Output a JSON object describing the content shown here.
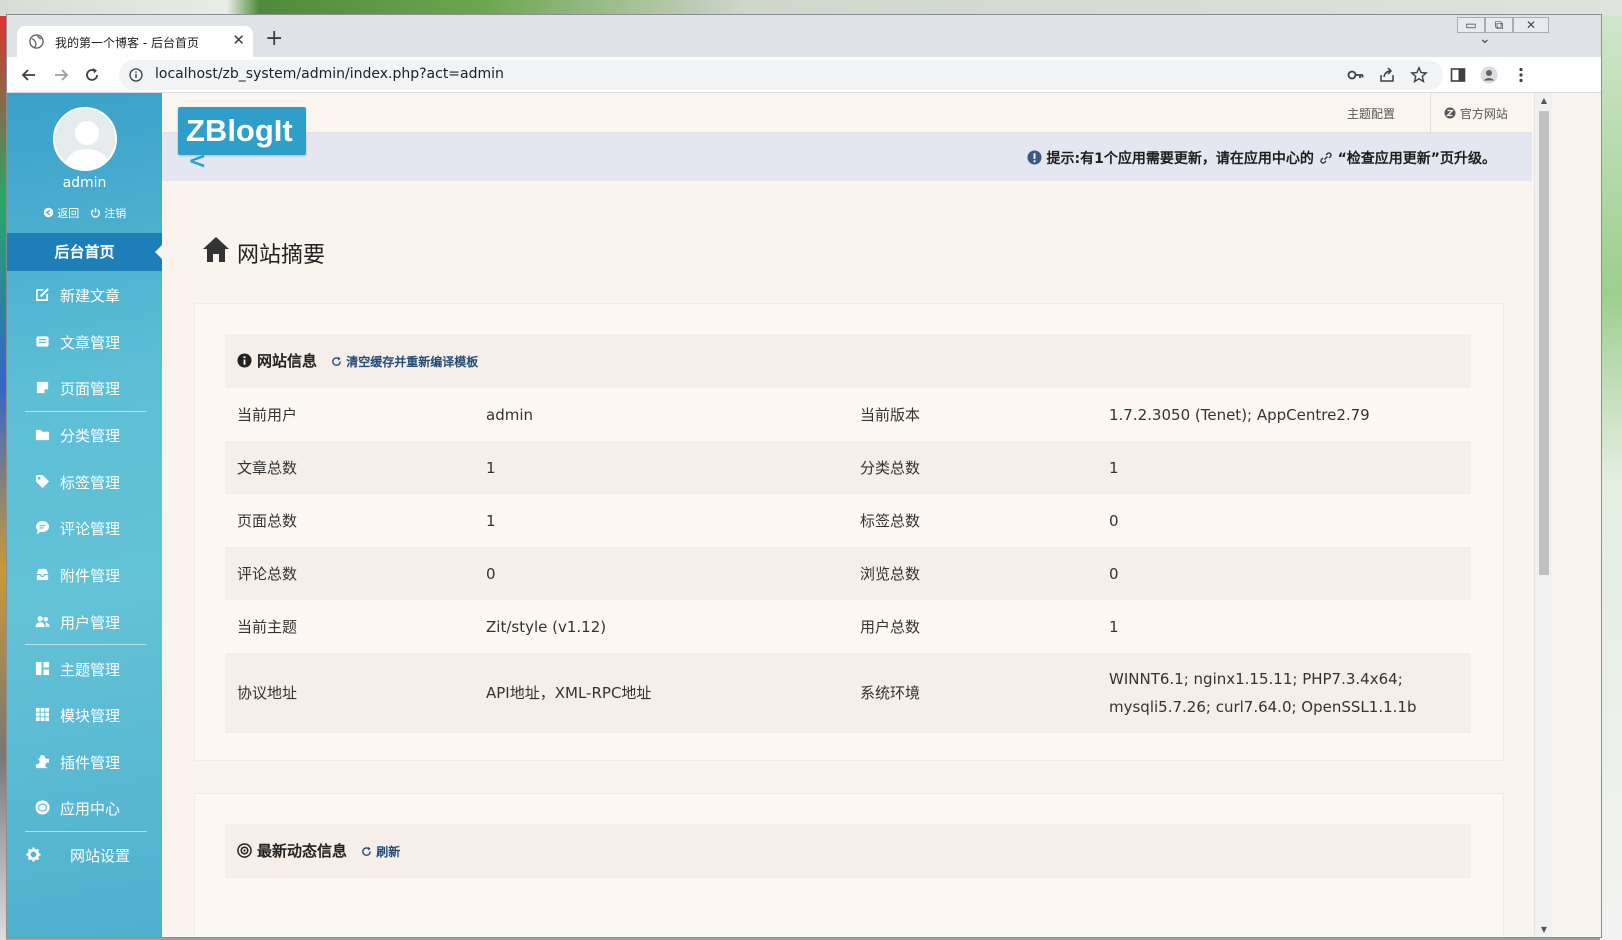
{
  "browser": {
    "tab_title": "我的第一个博客 - 后台首页",
    "tab_close": "✕",
    "new_tab": "+",
    "tab_list": "⌄",
    "url": "localhost/zb_system/admin/index.php?act=admin",
    "window_controls": [
      "▭",
      "⧉",
      "✕"
    ]
  },
  "sidebar": {
    "user": "admin",
    "return_label": "返回",
    "logout_label": "注销",
    "home_label": "后台首页",
    "items": [
      {
        "label": "新建文章",
        "icon": "edit-icon"
      },
      {
        "label": "文章管理",
        "icon": "article-icon"
      },
      {
        "label": "页面管理",
        "icon": "page-icon"
      },
      {
        "label": "分类管理",
        "icon": "folder-icon"
      },
      {
        "label": "标签管理",
        "icon": "tag-icon"
      },
      {
        "label": "评论管理",
        "icon": "comment-icon"
      },
      {
        "label": "附件管理",
        "icon": "attachment-icon"
      },
      {
        "label": "用户管理",
        "icon": "users-icon"
      },
      {
        "label": "主题管理",
        "icon": "theme-icon"
      },
      {
        "label": "模块管理",
        "icon": "module-icon"
      },
      {
        "label": "插件管理",
        "icon": "plugin-icon"
      },
      {
        "label": "应用中心",
        "icon": "app-center-icon"
      },
      {
        "label": "网站设置",
        "icon": "gear-icon"
      }
    ]
  },
  "header": {
    "logo": "ZBlogIt",
    "logo_arrow": "<",
    "theme_config": "主题配置",
    "official_site": "官方网站",
    "notice_prefix": "提示:有1个应用需要更新，请在应用中心的",
    "notice_link": "“检查应用更新”",
    "notice_suffix": "页升级。"
  },
  "main": {
    "page_title": "网站摘要",
    "site_info": {
      "title": "网站信息",
      "action": "清空缓存并重新编译模板",
      "rows": [
        {
          "k1": "当前用户",
          "v1": "admin",
          "k2": "当前版本",
          "v2": "1.7.2.3050 (Tenet); AppCentre2.79"
        },
        {
          "k1": "文章总数",
          "v1": "1",
          "k2": "分类总数",
          "v2": "1"
        },
        {
          "k1": "页面总数",
          "v1": "1",
          "k2": "标签总数",
          "v2": "0"
        },
        {
          "k1": "评论总数",
          "v1": "0",
          "k2": "浏览总数",
          "v2": "0"
        },
        {
          "k1": "当前主题",
          "v1": "Zit/style (v1.12)",
          "k2": "用户总数",
          "v2": "1"
        },
        {
          "k1": "协议地址",
          "v1_a": "API地址",
          "v1_sep": "，",
          "v1_b": "XML-RPC地址",
          "k2": "系统环境",
          "v2_line1": "WINNT6.1; nginx1.15.11; PHP7.3.4x64;",
          "v2_line2": "mysqli5.7.26; curl7.64.0; OpenSSL1.1.1b"
        }
      ]
    },
    "latest": {
      "title": "最新动态信息",
      "action": "刷新"
    }
  },
  "colors": {
    "sidebar_accent": "#1e7fb8",
    "sidebar_bg": "#5cbfd6",
    "logo_bg": "#2f9fca",
    "content_bg": "#faf4ee"
  }
}
